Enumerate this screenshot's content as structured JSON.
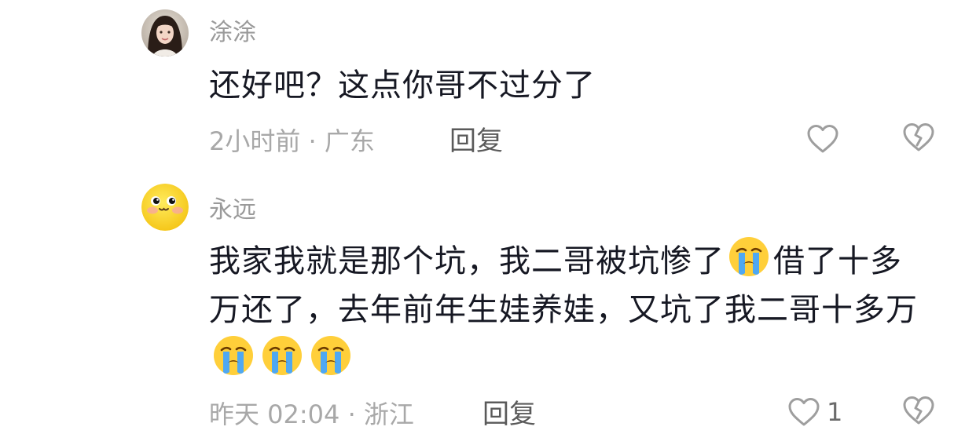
{
  "comments": [
    {
      "username": "涂涂",
      "text": "还好吧？这点你哥不过分了",
      "time_location": "2小时前 · 广东",
      "reply_label": "回复",
      "like_count": "",
      "avatar": "photo-avatar"
    },
    {
      "username": "永远",
      "text_parts": [
        "我家我就是那个坑，我二哥被坑惨了",
        "借了十多万还了，去年前年生娃养娃，又坑了我二哥十多万"
      ],
      "emoji": "loudly-crying-face",
      "time_location": "昨天 02:04 · 浙江",
      "reply_label": "回复",
      "like_count": "1",
      "avatar": "yellow-cartoon-face-avatar"
    }
  ],
  "icons": {
    "like": "heart-outline-icon",
    "dislike": "broken-heart-icon"
  },
  "colors": {
    "text_primary": "#161823",
    "text_secondary": "#a8a8a8",
    "icon_gray": "#9e9e9e"
  }
}
